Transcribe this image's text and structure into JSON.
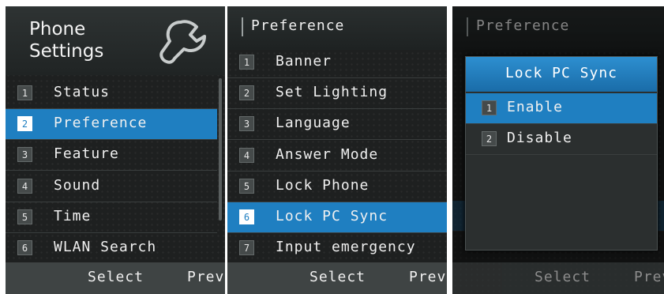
{
  "screen1": {
    "title_line1": "Phone",
    "title_line2": "Settings",
    "items": [
      {
        "num": "1",
        "label": "Status"
      },
      {
        "num": "2",
        "label": "Preference"
      },
      {
        "num": "3",
        "label": "Feature"
      },
      {
        "num": "4",
        "label": "Sound"
      },
      {
        "num": "5",
        "label": "Time"
      },
      {
        "num": "6",
        "label": "WLAN Search"
      }
    ],
    "selected_index": 1,
    "softkeys": {
      "select": "Select",
      "prev": "Prev"
    }
  },
  "screen2": {
    "title": "Preference",
    "items": [
      {
        "num": "1",
        "label": "Banner"
      },
      {
        "num": "2",
        "label": "Set Lighting"
      },
      {
        "num": "3",
        "label": "Language"
      },
      {
        "num": "4",
        "label": "Answer Mode"
      },
      {
        "num": "5",
        "label": "Lock Phone"
      },
      {
        "num": "6",
        "label": "Lock PC Sync"
      },
      {
        "num": "7",
        "label": "Input emergency"
      }
    ],
    "selected_index": 5,
    "softkeys": {
      "select": "Select",
      "prev": "Prev"
    }
  },
  "screen3": {
    "title": "Preference",
    "popup_title": "Lock PC Sync",
    "options": [
      {
        "num": "1",
        "label": "Enable"
      },
      {
        "num": "2",
        "label": "Disable"
      }
    ],
    "selected_index": 0,
    "softkeys": {
      "select": "Select",
      "prev": "Prev"
    }
  },
  "colors": {
    "accent": "#1f7fc1",
    "background": "#1e2020",
    "softbar": "#3f4444"
  },
  "icons": {
    "settings": "wrench-icon"
  }
}
